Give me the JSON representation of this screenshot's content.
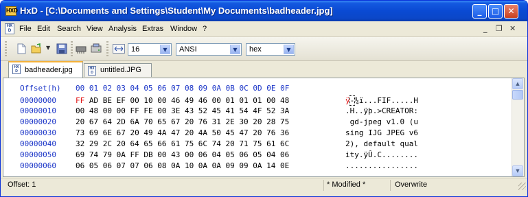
{
  "window": {
    "title": "HxD - [C:\\Documents and Settings\\Student\\My Documents\\badheader.jpg]",
    "app_icon_text": "HXD",
    "controls": {
      "minimize": "_",
      "maximize": "□",
      "close": "✕"
    }
  },
  "menubar": {
    "items": [
      "File",
      "Edit",
      "Search",
      "View",
      "Analysis",
      "Extras",
      "Window",
      "?"
    ],
    "mdi_controls": {
      "minimize": "_",
      "restore": "❐",
      "close": "✕"
    }
  },
  "toolbar": {
    "bytes_per_row": "16",
    "charset": "ANSI",
    "offset_base": "hex",
    "icons": [
      "new-file-icon",
      "open-folder-icon",
      "save-disk-icon",
      "ram-chip-icon",
      "disk-drive-icon",
      "column-width-icon"
    ]
  },
  "tabs": [
    {
      "label": "badheader.jpg",
      "active": true
    },
    {
      "label": "untitled.JPG",
      "active": false
    }
  ],
  "editor": {
    "header_label": "Offset(h)",
    "column_headers": [
      "00",
      "01",
      "02",
      "03",
      "04",
      "05",
      "06",
      "07",
      "08",
      "09",
      "0A",
      "0B",
      "0C",
      "0D",
      "0E",
      "0F"
    ],
    "selected_byte": "FF",
    "rows": [
      {
        "offset": "00000000",
        "bytes_rest": " AD BE EF 00 10 00 46 49 46 00 01 01 01 00 48",
        "ascii": "ÿ-¾ï...FIF.....H"
      },
      {
        "offset": "00000010",
        "bytes": "00 48 00 00 FF FE 00 3E 43 52 45 41 54 4F 52 3A",
        "ascii": ".H..ÿþ.>CREATOR:"
      },
      {
        "offset": "00000020",
        "bytes": "20 67 64 2D 6A 70 65 67 20 76 31 2E 30 20 28 75",
        "ascii": " gd-jpeg v1.0 (u"
      },
      {
        "offset": "00000030",
        "bytes": "73 69 6E 67 20 49 4A 47 20 4A 50 45 47 20 76 36",
        "ascii": "sing IJG JPEG v6"
      },
      {
        "offset": "00000040",
        "bytes": "32 29 2C 20 64 65 66 61 75 6C 74 20 71 75 61 6C",
        "ascii": "2), default qual"
      },
      {
        "offset": "00000050",
        "bytes": "69 74 79 0A FF DB 00 43 00 06 04 05 06 05 04 06",
        "ascii": "ity.ÿÛ.C........"
      },
      {
        "offset": "00000060",
        "bytes": "06 05 06 07 07 06 08 0A 10 0A 0A 09 09 0A 14 0E",
        "ascii": "................"
      }
    ]
  },
  "statusbar": {
    "offset": "Offset: 1",
    "modified": "* Modified *",
    "mode": "Overwrite"
  },
  "colors": {
    "titlebar": "#0a4ad3",
    "offset_blue": "#1c36c8",
    "selection_red": "#e01010",
    "tab_accent": "#f3b13a"
  }
}
